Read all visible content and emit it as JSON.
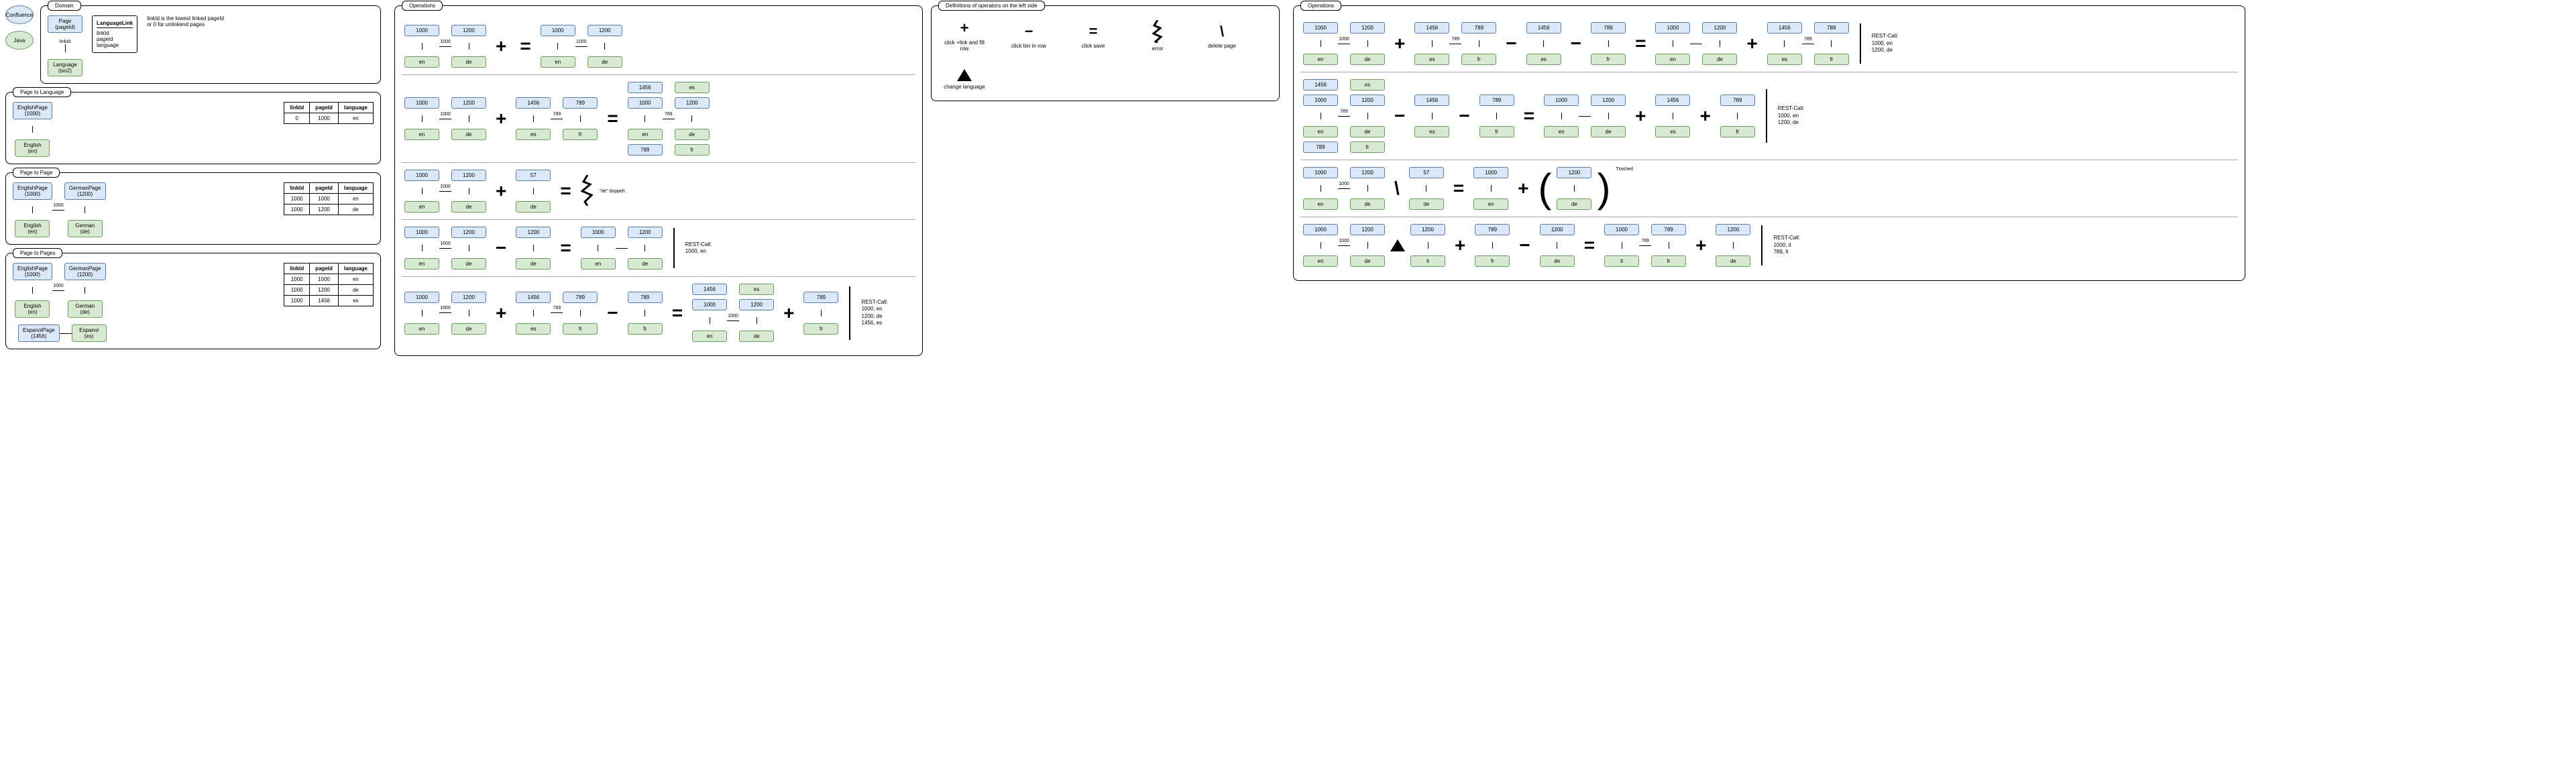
{
  "domain": {
    "title": "Domain",
    "confluence": "Confluence",
    "java": "Java",
    "page_label": "Page\n(pageId)",
    "lang_label": "Language\n(iso2)",
    "link_arrow": "linkId",
    "ll_title": "LanguageLink",
    "ll_fields": [
      "linkId",
      "pageId",
      "language"
    ],
    "note": "linkId is the lowest linked pageId or 0 for unlinkend pages"
  },
  "p2l": {
    "title": "Page to Language",
    "page": "EnglishPage\n(1000)",
    "lang": "English\n(en)",
    "table_head": [
      "linkId",
      "pageId",
      "language"
    ],
    "table_rows": [
      [
        "0",
        "1000",
        "en"
      ]
    ]
  },
  "p2p": {
    "title": "Page to Page",
    "pages": [
      "EnglishPage\n(1000)",
      "GermanPage\n(1200)"
    ],
    "langs": [
      "English\n(en)",
      "German\n(de)"
    ],
    "hlabel": "1000",
    "table_head": [
      "linkId",
      "pageId",
      "language"
    ],
    "table_rows": [
      [
        "1000",
        "1000",
        "en"
      ],
      [
        "1000",
        "1200",
        "de"
      ]
    ]
  },
  "p2ps": {
    "title": "Page to Pages",
    "p_en": "EnglishPage\n(1000)",
    "p_de": "GermanPage\n(1200)",
    "p_es": "EspanolPage\n(1456)",
    "l_en": "English\n(en)",
    "l_de": "German\n(de)",
    "l_es": "Espanol\n(es)",
    "hlabel": "1000",
    "table_head": [
      "linkId",
      "pageId",
      "language"
    ],
    "table_rows": [
      [
        "1000",
        "1000",
        "en"
      ],
      [
        "1000",
        "1200",
        "de"
      ],
      [
        "1000",
        "1456",
        "es"
      ]
    ]
  },
  "ops": {
    "title": "Operations",
    "legend_title": "Definitions of operators on the left side",
    "legend": {
      "plus": "click +link and fill row",
      "minus": "click bin in row",
      "eq": "click save",
      "zig": "error",
      "slash": "delete page",
      "tri": "change language"
    },
    "linkid_1000": "1000",
    "linkid_789": "789",
    "de_doppelt": "\"de\" doppelt",
    "rows": {
      "r1": {
        "a": [
          [
            "1000",
            "en"
          ],
          [
            "1200",
            "de"
          ]
        ],
        "op": "+",
        "eq": "=",
        "b": [
          [
            "1000",
            "en"
          ],
          [
            "1200",
            "de"
          ]
        ]
      },
      "r2": {
        "a": [
          [
            "1000",
            "en"
          ],
          [
            "1200",
            "de"
          ]
        ],
        "b": [
          [
            "1456",
            "es"
          ],
          [
            "789",
            "fr"
          ]
        ],
        "res_top": [
          [
            "1456",
            "es"
          ]
        ],
        "res_mid": [
          [
            "1000",
            "en"
          ],
          [
            "1200",
            "de"
          ]
        ],
        "res_bot": [
          [
            "789",
            "fr"
          ]
        ]
      },
      "r3": {
        "a": [
          [
            "1000",
            "en"
          ],
          [
            "1200",
            "de"
          ]
        ],
        "b": [
          [
            "57",
            "de"
          ]
        ]
      },
      "r4": {
        "a": [
          [
            "1000",
            "en"
          ],
          [
            "1200",
            "de"
          ]
        ],
        "b": [
          [
            "1200",
            "de"
          ]
        ],
        "res": [
          [
            "1000",
            "en"
          ],
          [
            "1200",
            "de"
          ]
        ],
        "rest": "REST-Call:\n1000, en"
      },
      "r5": {
        "a": [
          [
            "1000",
            "en"
          ],
          [
            "1200",
            "de"
          ]
        ],
        "b": [
          [
            "1456",
            "es"
          ],
          [
            "789",
            "fr"
          ]
        ],
        "c": [
          [
            "789",
            "fr"
          ]
        ],
        "res_single": [
          [
            "1456",
            "es"
          ]
        ],
        "res_pair": [
          [
            "1000",
            "en"
          ],
          [
            "1200",
            "de"
          ]
        ],
        "res_r": [
          [
            "789",
            "fr"
          ]
        ],
        "rest": "REST-Call:\n1000, en\n1200, de\n1456, es"
      }
    }
  },
  "ops2": {
    "title": "Operations",
    "rows": {
      "r1": {
        "a": [
          [
            "1000",
            "en"
          ],
          [
            "1200",
            "de"
          ]
        ],
        "b": [
          [
            "1456",
            "es"
          ],
          [
            "789",
            "fr"
          ]
        ],
        "c": [
          [
            "1456",
            "es"
          ]
        ],
        "d": [
          [
            "789",
            "fr"
          ]
        ],
        "res_l": [
          [
            "1000",
            "en"
          ],
          [
            "1200",
            "de"
          ]
        ],
        "res_r": [
          [
            "1456",
            "es"
          ],
          [
            "789",
            "fr"
          ]
        ],
        "rest": "REST-Call:\n1000, en\n1200, de"
      },
      "r2": {
        "top": [
          [
            "1456",
            "es"
          ]
        ],
        "a": [
          [
            "1000",
            "en"
          ],
          [
            "1200",
            "de"
          ]
        ],
        "bot": [
          [
            "789",
            "fr"
          ]
        ],
        "b": [
          [
            "1456",
            "es"
          ]
        ],
        "c": [
          [
            "789",
            "fr"
          ]
        ],
        "res": [
          [
            "1000",
            "en"
          ],
          [
            "1200",
            "de"
          ]
        ],
        "r2": [
          [
            "1456",
            "es"
          ]
        ],
        "r3": [
          [
            "789",
            "fr"
          ]
        ],
        "rest": "REST-Call:\n1000, en\n1200, de"
      },
      "r3": {
        "a": [
          [
            "1000",
            "en"
          ],
          [
            "1200",
            "de"
          ]
        ],
        "b": [
          [
            "57",
            "de"
          ]
        ],
        "res": [
          [
            "1000",
            "en"
          ]
        ],
        "paren": [
          [
            "1200",
            "de"
          ]
        ],
        "trashed": "Trashed"
      },
      "r4": {
        "a": [
          [
            "1000",
            "en"
          ],
          [
            "1200",
            "de"
          ]
        ],
        "tri": "▲",
        "b": [
          [
            "1200",
            "it"
          ]
        ],
        "c": [
          [
            "789",
            "fr"
          ]
        ],
        "d": [
          [
            "1200",
            "de"
          ]
        ],
        "res": [
          [
            "1000",
            "it"
          ],
          [
            "789",
            "fr"
          ]
        ],
        "r2": [
          [
            "1200",
            "de"
          ]
        ],
        "rest": "REST-Call:\n1000, it\n789, fr"
      }
    }
  },
  "common": {
    "plus": "+",
    "minus": "−",
    "eq": "=",
    "slash": "\\"
  }
}
